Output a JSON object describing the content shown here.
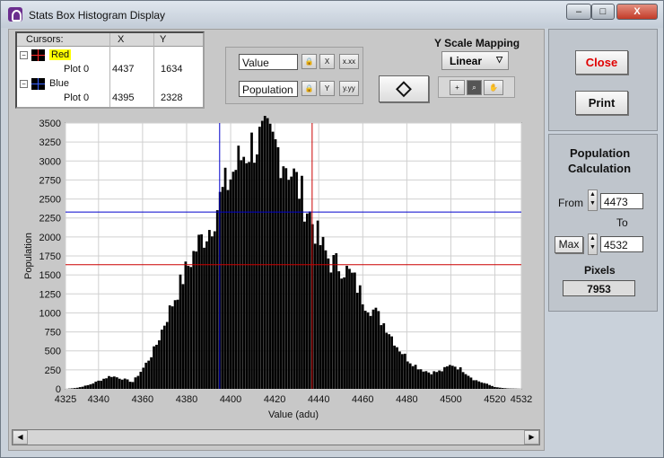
{
  "window": {
    "title": "Stats Box Histogram Display",
    "minimize_icon": "minimize-icon",
    "maximize_icon": "maximize-icon",
    "close_icon": "close-x-icon",
    "min_label": "–",
    "max_label": "□",
    "close_label": "X"
  },
  "cursors": {
    "headers": [
      "Cursors:",
      "X",
      "Y"
    ],
    "items": [
      {
        "name": "Red",
        "plot": "Plot 0",
        "x": "4437",
        "y": "1634"
      },
      {
        "name": "Blue",
        "plot": "Plot 0",
        "x": "4395",
        "y": "2328"
      }
    ]
  },
  "scales": {
    "x_name": "Value",
    "y_name": "Population",
    "x_btn1": "X",
    "x_btn2": "x.xx",
    "y_btn1": "Y",
    "y_btn2": "y.yy"
  },
  "yscale": {
    "label": "Y Scale Mapping",
    "value": "Linear"
  },
  "buttons": {
    "close": "Close",
    "print": "Print",
    "max": "Max"
  },
  "population": {
    "title_line1": "Population",
    "title_line2": "Calculation",
    "from_label": "From",
    "from_value": "4473",
    "to_label": "To",
    "to_value": "4532",
    "pixels_label": "Pixels",
    "pixels_value": "7953"
  },
  "chart_data": {
    "type": "bar",
    "xlabel": "Value (adu)",
    "ylabel": "Population",
    "xlim": [
      4325,
      4532
    ],
    "ylim": [
      0,
      3500
    ],
    "xticks": [
      "4325",
      "4340",
      "4360",
      "4380",
      "4400",
      "4420",
      "4440",
      "4460",
      "4480",
      "4500",
      "4520",
      "4532"
    ],
    "yticks": [
      "0",
      "250",
      "500",
      "750",
      "1000",
      "1250",
      "1500",
      "1750",
      "2000",
      "2250",
      "2500",
      "2750",
      "3000",
      "3250",
      "3500"
    ],
    "cursor_red": {
      "x": 4437,
      "y": 1634,
      "color": "#cc0000"
    },
    "cursor_blue": {
      "x": 4395,
      "y": 2328,
      "color": "#0000cc"
    },
    "series": [
      {
        "x": [
          4325,
          4330,
          4335,
          4340,
          4345,
          4350,
          4355,
          4360,
          4365,
          4370,
          4375,
          4380,
          4385,
          4390,
          4395,
          4400,
          4405,
          4410,
          4415,
          4420,
          4425,
          4430,
          4435,
          4440,
          4445,
          4450,
          4455,
          4460,
          4465,
          4470,
          4475,
          4480,
          4485,
          4490,
          4495,
          4500,
          4505,
          4510,
          4515,
          4520,
          4525,
          4532
        ],
        "values": [
          0,
          15,
          50,
          110,
          170,
          135,
          90,
          280,
          520,
          900,
          1250,
          1600,
          1900,
          2100,
          2500,
          2800,
          3050,
          3200,
          3250,
          3150,
          2950,
          2650,
          2300,
          1900,
          1650,
          1600,
          1450,
          1150,
          1000,
          820,
          560,
          380,
          270,
          210,
          230,
          320,
          240,
          120,
          70,
          20,
          5,
          0
        ]
      }
    ]
  }
}
